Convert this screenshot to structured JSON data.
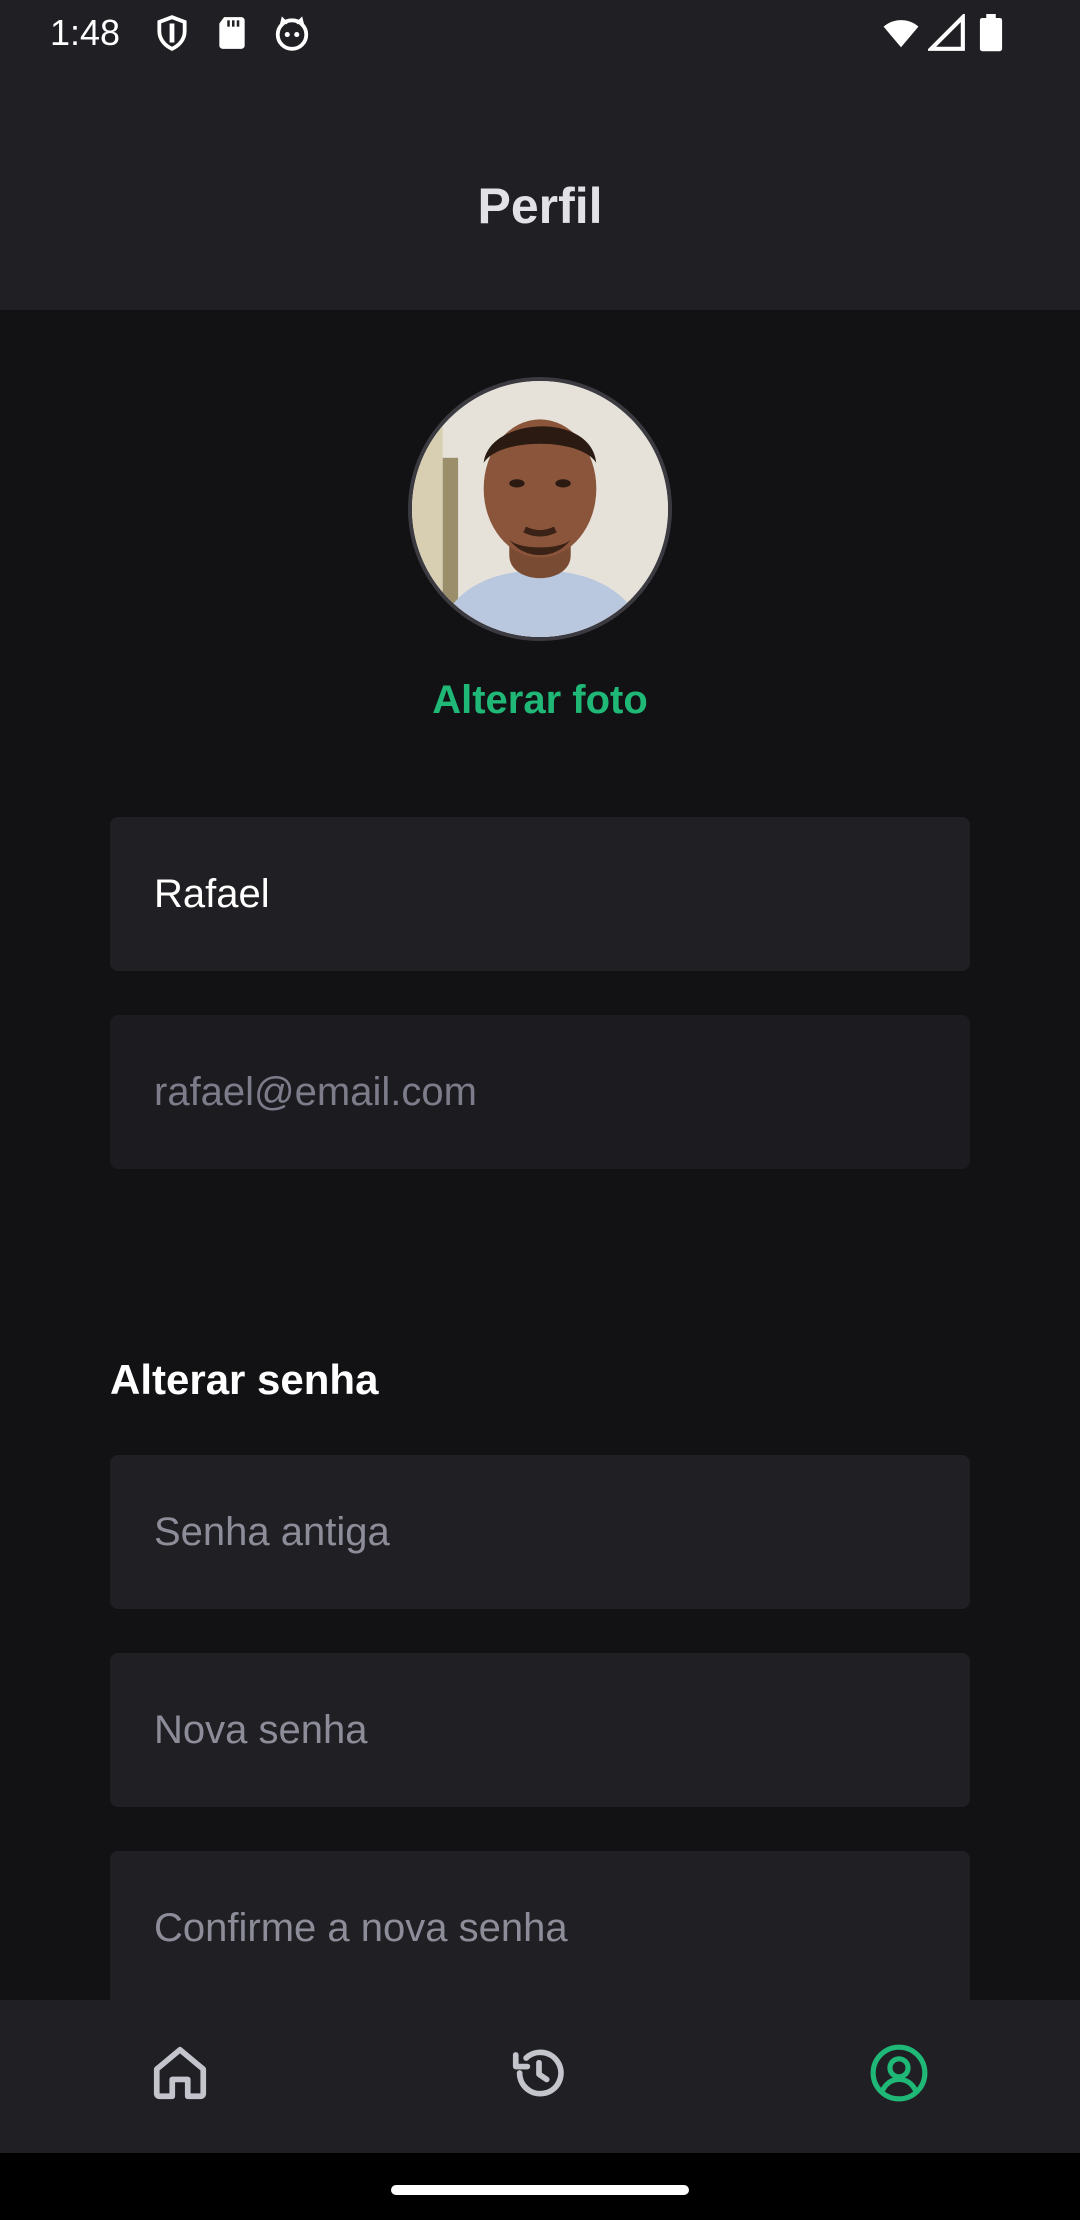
{
  "status_bar": {
    "time": "1:48"
  },
  "header": {
    "title": "Perfil"
  },
  "profile": {
    "change_photo_label": "Alterar foto",
    "name_value": "Rafael",
    "email_value": "rafael@email.com"
  },
  "password": {
    "section_title": "Alterar senha",
    "old_placeholder": "Senha antiga",
    "new_placeholder": "Nova senha",
    "confirm_placeholder": "Confirme a nova senha"
  },
  "tabs": [
    {
      "icon": "home-icon"
    },
    {
      "icon": "history-icon"
    },
    {
      "icon": "user-circle-icon",
      "active": true
    }
  ],
  "colors": {
    "accent": "#1fb877",
    "background": "#121214",
    "surface": "#202024",
    "inactive_icon": "#c4c4cc"
  }
}
